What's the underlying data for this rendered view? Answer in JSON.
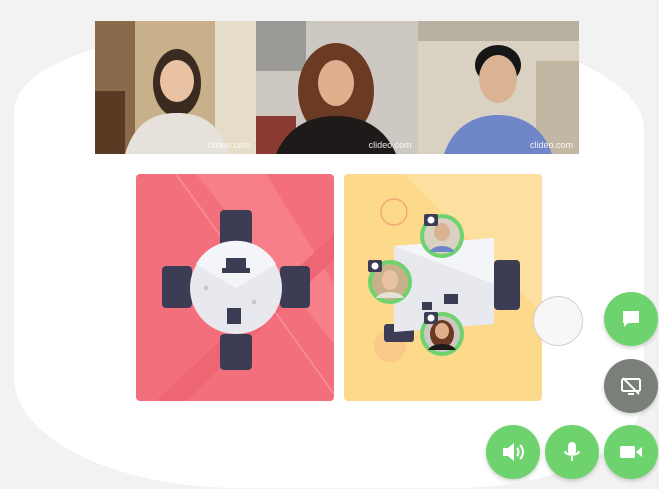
{
  "colors": {
    "accent": "#6ed36f",
    "room_left": "#f36f7c",
    "room_right": "#fdd98b",
    "chair": "#3d3c55",
    "table": "#e7e9ee"
  },
  "video_feeds": [
    {
      "participant": "participant-1",
      "watermark": "clideo.com"
    },
    {
      "participant": "participant-2",
      "watermark": "clideo.com"
    },
    {
      "participant": "participant-3",
      "watermark": "clideo.com"
    }
  ],
  "controls": {
    "chat": "chat-bubble-icon",
    "screen_share": "screen-share-off-icon",
    "speaker": "speaker-icon",
    "microphone": "microphone-icon",
    "camera": "video-camera-icon"
  }
}
